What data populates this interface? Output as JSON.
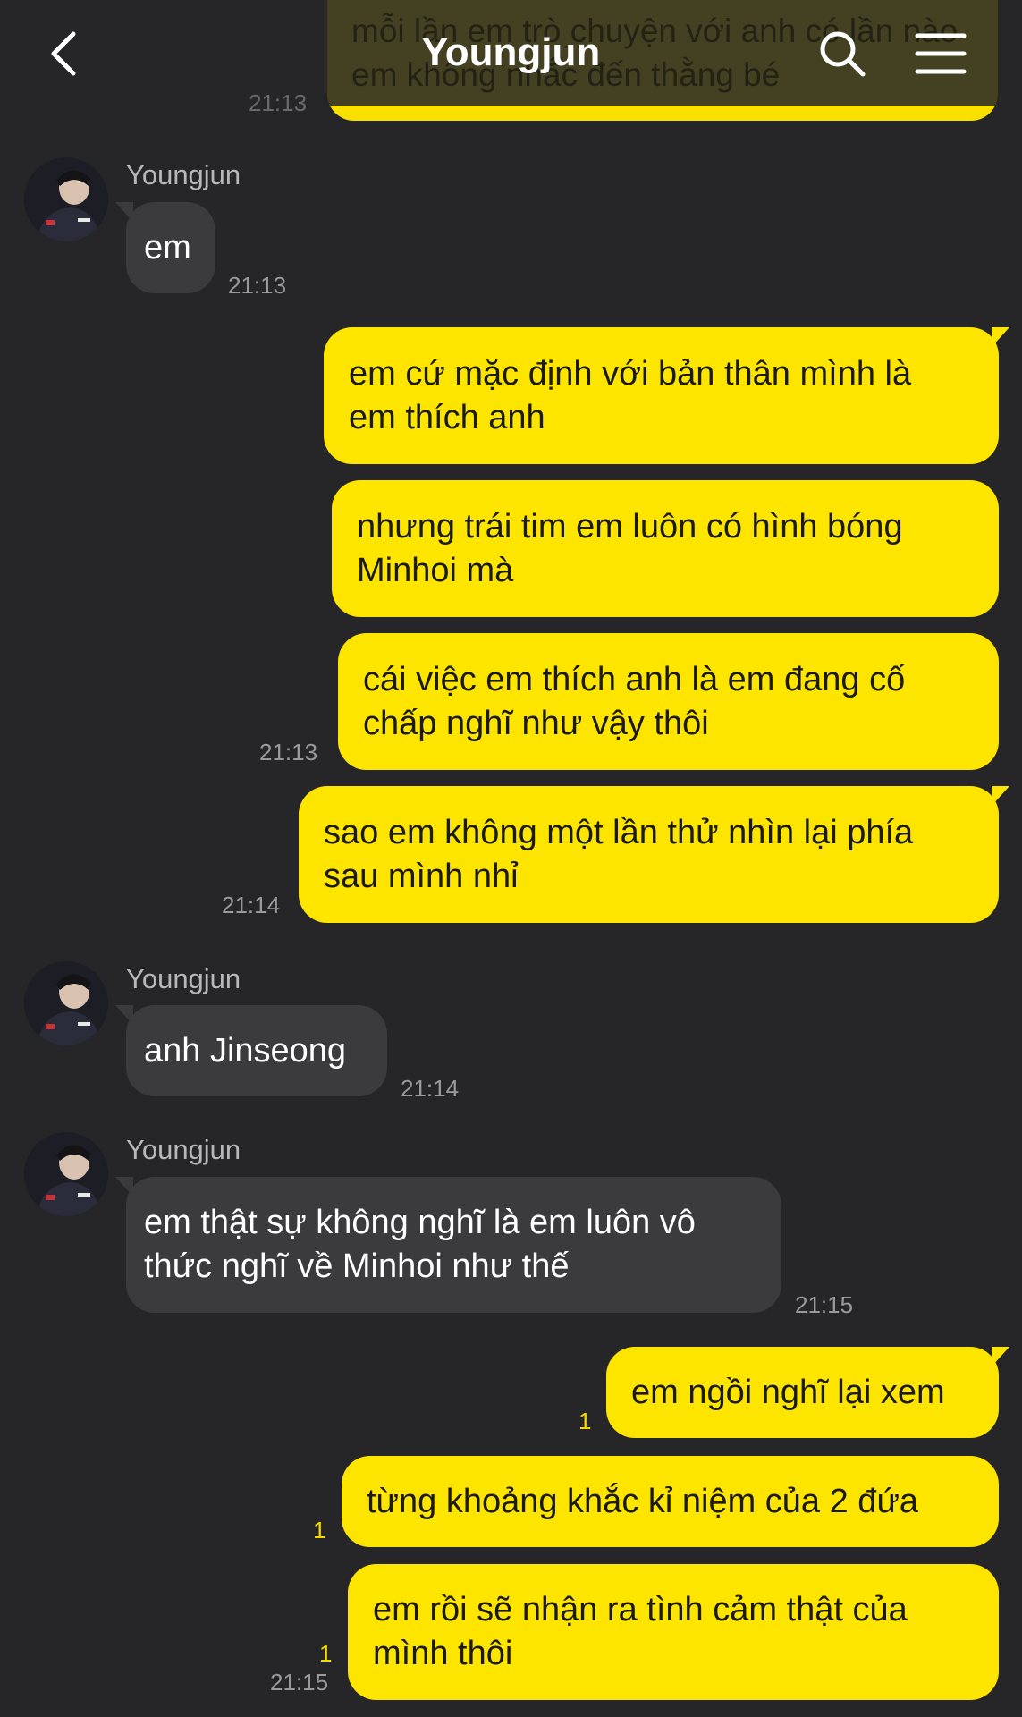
{
  "header": {
    "title": "Youngjun",
    "back_icon": "chevron-left-icon",
    "search_icon": "search-icon",
    "menu_icon": "hamburger-menu-icon"
  },
  "colors": {
    "background": "#262629",
    "outgoing_bubble": "#fee500",
    "incoming_bubble": "#3b3b3e",
    "unread": "#f7d900"
  },
  "cutoff_message": {
    "text": "mỗi lần em trò chuyện với anh có lần nào em không nhắc đến thằng bé",
    "time": "21:13"
  },
  "messages": [
    {
      "sender": "Youngjun",
      "text": "em",
      "time": "21:13"
    },
    {
      "text_l1": "em cứ mặc định với bản thân mình là",
      "text_l2": "em thích anh"
    },
    {
      "text_l1": "nhưng trái tim em luôn có hình bóng",
      "text_l2": "Minhoi mà"
    },
    {
      "text_l1": "cái việc em thích anh là em đang cố",
      "text_l2": "chấp nghĩ như vậy thôi",
      "time": "21:13"
    },
    {
      "text_l1": "sao em không một lần thử nhìn lại phía",
      "text_l2": "sau mình nhỉ",
      "time": "21:14"
    },
    {
      "sender": "Youngjun",
      "text": "anh Jinseong",
      "time": "21:14"
    },
    {
      "sender": "Youngjun",
      "text_l1": "em thật sự không nghĩ là em luôn vô",
      "text_l2": "thức nghĩ về Minhoi như thế",
      "time": "21:15"
    },
    {
      "text": "em ngồi nghĩ lại xem",
      "unread": "1"
    },
    {
      "text": "từng khoảng khắc kỉ niệm của 2 đứa",
      "unread": "1"
    },
    {
      "text_l1": "em rồi sẽ nhận ra tình cảm thật của",
      "text_l2": "mình thôi",
      "unread": "1",
      "time": "21:15"
    }
  ]
}
